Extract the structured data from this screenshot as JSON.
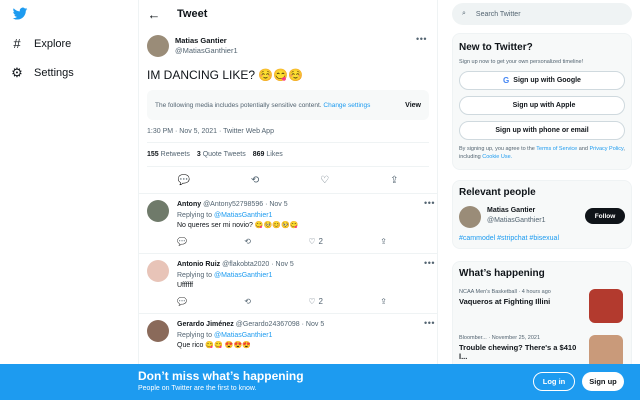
{
  "nav": {
    "items": [
      {
        "label": "Explore",
        "icon": "hash-icon"
      },
      {
        "label": "Settings",
        "icon": "gear-icon"
      }
    ]
  },
  "header": {
    "title": "Tweet"
  },
  "tweet": {
    "name": "Matias Gantier",
    "handle": "@MatiasGanthier1",
    "text": "IM DANCING LIKE? ☺️😋☺️",
    "sensitive_text": "The following media includes potentially sensitive content.",
    "sensitive_link": "Change settings",
    "view_label": "View",
    "meta": "1:30 PM · Nov 5, 2021 · Twitter Web App",
    "retweets": "155",
    "retweets_label": "Retweets",
    "quotes": "3",
    "quotes_label": "Quote Tweets",
    "likes": "869",
    "likes_label": "Likes"
  },
  "replies": [
    {
      "name": "Antony",
      "handle": "@Antony52798596",
      "date": "· Nov 5",
      "replying": "Replying to",
      "mention": "@MatiasGanthier1",
      "text": "No queres ser mi novio? 😋🥺😊🥺😋",
      "likes": "2"
    },
    {
      "name": "Antonio Ruiz",
      "handle": "@flakobta2020",
      "date": "· Nov 5",
      "replying": "Replying to",
      "mention": "@MatiasGanthier1",
      "text": "Uffffff",
      "likes": "2"
    },
    {
      "name": "Gerardo Jiménez",
      "handle": "@Gerardo24367098",
      "date": "· Nov 5",
      "replying": "Replying to",
      "mention": "@MatiasGanthier1",
      "text": "Que rico 😋😋 😍😍😍",
      "likes": ""
    }
  ],
  "search": {
    "placeholder": "Search Twitter"
  },
  "new_to_twitter": {
    "title": "New to Twitter?",
    "subtitle": "Sign up now to get your own personalized timeline!",
    "google": "Sign up with Google",
    "apple": "Sign up with Apple",
    "phone": "Sign up with phone or email",
    "terms_prefix": "By signing up, you agree to the",
    "terms_link": "Terms of Service",
    "and": "and",
    "privacy_link": "Privacy Policy",
    "including": ", including",
    "cookie_link": "Cookie Use."
  },
  "relevant": {
    "title": "Relevant people",
    "name": "Matias Gantier",
    "handle": "@MatiasGanthier1",
    "follow": "Follow",
    "bio": "#cammodel #stripchat #bisexual"
  },
  "happening": {
    "title": "What’s happening",
    "trends": [
      {
        "category": "NCAA Men's Basketball · 4 hours ago",
        "title": "Vaqueros at Fighting Illini"
      },
      {
        "category": "Bloomber... · November 25, 2021",
        "title": "Trouble chewing? There's a $410 l..."
      }
    ]
  },
  "bottom": {
    "headline": "Don’t miss what’s happening",
    "subline": "People on Twitter are the first to know.",
    "login": "Log in",
    "signup": "Sign up"
  },
  "colors": {
    "accent": "#1d9bf0",
    "dark": "#0f1419",
    "muted": "#536471"
  }
}
